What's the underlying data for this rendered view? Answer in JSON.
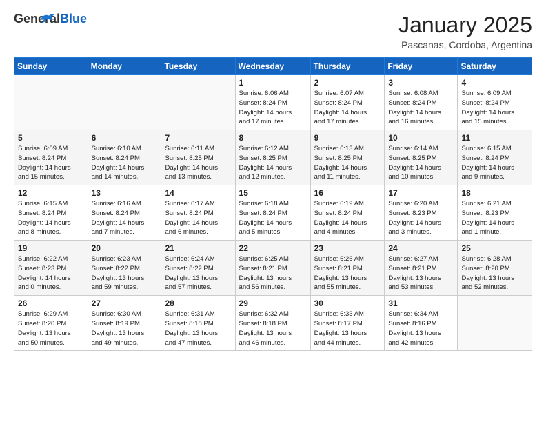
{
  "header": {
    "logo_general": "General",
    "logo_blue": "Blue",
    "month_title": "January 2025",
    "location": "Pascanas, Cordoba, Argentina"
  },
  "weekdays": [
    "Sunday",
    "Monday",
    "Tuesday",
    "Wednesday",
    "Thursday",
    "Friday",
    "Saturday"
  ],
  "weeks": [
    [
      {
        "day": "",
        "info": ""
      },
      {
        "day": "",
        "info": ""
      },
      {
        "day": "",
        "info": ""
      },
      {
        "day": "1",
        "info": "Sunrise: 6:06 AM\nSunset: 8:24 PM\nDaylight: 14 hours\nand 17 minutes."
      },
      {
        "day": "2",
        "info": "Sunrise: 6:07 AM\nSunset: 8:24 PM\nDaylight: 14 hours\nand 17 minutes."
      },
      {
        "day": "3",
        "info": "Sunrise: 6:08 AM\nSunset: 8:24 PM\nDaylight: 14 hours\nand 16 minutes."
      },
      {
        "day": "4",
        "info": "Sunrise: 6:09 AM\nSunset: 8:24 PM\nDaylight: 14 hours\nand 15 minutes."
      }
    ],
    [
      {
        "day": "5",
        "info": "Sunrise: 6:09 AM\nSunset: 8:24 PM\nDaylight: 14 hours\nand 15 minutes."
      },
      {
        "day": "6",
        "info": "Sunrise: 6:10 AM\nSunset: 8:24 PM\nDaylight: 14 hours\nand 14 minutes."
      },
      {
        "day": "7",
        "info": "Sunrise: 6:11 AM\nSunset: 8:25 PM\nDaylight: 14 hours\nand 13 minutes."
      },
      {
        "day": "8",
        "info": "Sunrise: 6:12 AM\nSunset: 8:25 PM\nDaylight: 14 hours\nand 12 minutes."
      },
      {
        "day": "9",
        "info": "Sunrise: 6:13 AM\nSunset: 8:25 PM\nDaylight: 14 hours\nand 11 minutes."
      },
      {
        "day": "10",
        "info": "Sunrise: 6:14 AM\nSunset: 8:25 PM\nDaylight: 14 hours\nand 10 minutes."
      },
      {
        "day": "11",
        "info": "Sunrise: 6:15 AM\nSunset: 8:24 PM\nDaylight: 14 hours\nand 9 minutes."
      }
    ],
    [
      {
        "day": "12",
        "info": "Sunrise: 6:15 AM\nSunset: 8:24 PM\nDaylight: 14 hours\nand 8 minutes."
      },
      {
        "day": "13",
        "info": "Sunrise: 6:16 AM\nSunset: 8:24 PM\nDaylight: 14 hours\nand 7 minutes."
      },
      {
        "day": "14",
        "info": "Sunrise: 6:17 AM\nSunset: 8:24 PM\nDaylight: 14 hours\nand 6 minutes."
      },
      {
        "day": "15",
        "info": "Sunrise: 6:18 AM\nSunset: 8:24 PM\nDaylight: 14 hours\nand 5 minutes."
      },
      {
        "day": "16",
        "info": "Sunrise: 6:19 AM\nSunset: 8:24 PM\nDaylight: 14 hours\nand 4 minutes."
      },
      {
        "day": "17",
        "info": "Sunrise: 6:20 AM\nSunset: 8:23 PM\nDaylight: 14 hours\nand 3 minutes."
      },
      {
        "day": "18",
        "info": "Sunrise: 6:21 AM\nSunset: 8:23 PM\nDaylight: 14 hours\nand 1 minute."
      }
    ],
    [
      {
        "day": "19",
        "info": "Sunrise: 6:22 AM\nSunset: 8:23 PM\nDaylight: 14 hours\nand 0 minutes."
      },
      {
        "day": "20",
        "info": "Sunrise: 6:23 AM\nSunset: 8:22 PM\nDaylight: 13 hours\nand 59 minutes."
      },
      {
        "day": "21",
        "info": "Sunrise: 6:24 AM\nSunset: 8:22 PM\nDaylight: 13 hours\nand 57 minutes."
      },
      {
        "day": "22",
        "info": "Sunrise: 6:25 AM\nSunset: 8:21 PM\nDaylight: 13 hours\nand 56 minutes."
      },
      {
        "day": "23",
        "info": "Sunrise: 6:26 AM\nSunset: 8:21 PM\nDaylight: 13 hours\nand 55 minutes."
      },
      {
        "day": "24",
        "info": "Sunrise: 6:27 AM\nSunset: 8:21 PM\nDaylight: 13 hours\nand 53 minutes."
      },
      {
        "day": "25",
        "info": "Sunrise: 6:28 AM\nSunset: 8:20 PM\nDaylight: 13 hours\nand 52 minutes."
      }
    ],
    [
      {
        "day": "26",
        "info": "Sunrise: 6:29 AM\nSunset: 8:20 PM\nDaylight: 13 hours\nand 50 minutes."
      },
      {
        "day": "27",
        "info": "Sunrise: 6:30 AM\nSunset: 8:19 PM\nDaylight: 13 hours\nand 49 minutes."
      },
      {
        "day": "28",
        "info": "Sunrise: 6:31 AM\nSunset: 8:18 PM\nDaylight: 13 hours\nand 47 minutes."
      },
      {
        "day": "29",
        "info": "Sunrise: 6:32 AM\nSunset: 8:18 PM\nDaylight: 13 hours\nand 46 minutes."
      },
      {
        "day": "30",
        "info": "Sunrise: 6:33 AM\nSunset: 8:17 PM\nDaylight: 13 hours\nand 44 minutes."
      },
      {
        "day": "31",
        "info": "Sunrise: 6:34 AM\nSunset: 8:16 PM\nDaylight: 13 hours\nand 42 minutes."
      },
      {
        "day": "",
        "info": ""
      }
    ]
  ]
}
